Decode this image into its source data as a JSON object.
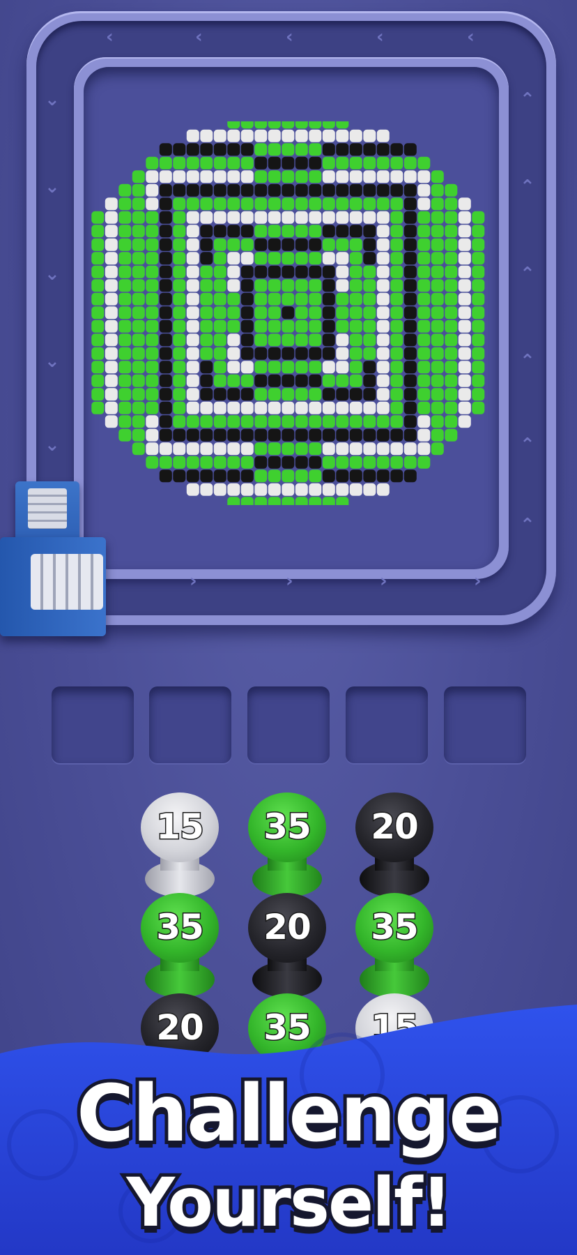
{
  "colors": {
    "background": "#4a4e96",
    "track": "#8c90d4",
    "feeder": "#2b5bb0",
    "banner": "#2c46e0",
    "pixel_green": "#3fd02f",
    "pixel_black": "#151515",
    "pixel_white": "#eaeaea"
  },
  "board": {
    "art": "concentric green, black and white rings in a round pixel mosaic",
    "icons": [
      "conveyor-arrow-icon"
    ]
  },
  "slots": {
    "count": 5
  },
  "spools": [
    {
      "value": "15",
      "color": "white"
    },
    {
      "value": "35",
      "color": "green"
    },
    {
      "value": "20",
      "color": "black"
    },
    {
      "value": "35",
      "color": "green"
    },
    {
      "value": "20",
      "color": "black"
    },
    {
      "value": "35",
      "color": "green"
    },
    {
      "value": "20",
      "color": "black"
    },
    {
      "value": "35",
      "color": "green"
    },
    {
      "value": "15",
      "color": "white"
    }
  ],
  "banner": {
    "line1": "Challenge",
    "line2": "Yourself!"
  }
}
